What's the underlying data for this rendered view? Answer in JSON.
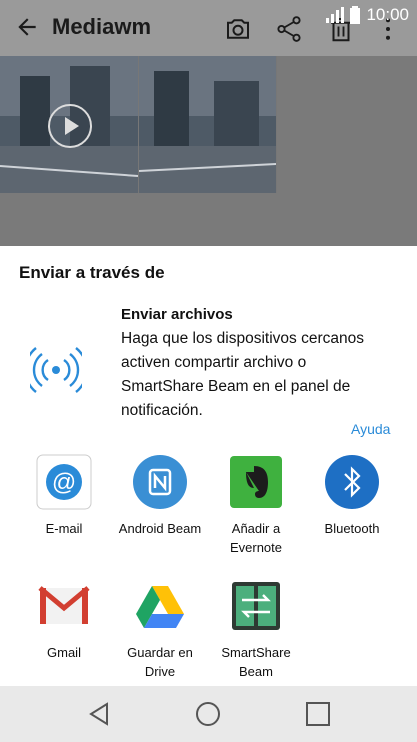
{
  "status_bar": {
    "time": "10:00"
  },
  "app_bar": {
    "title": "Mediawm"
  },
  "sheet": {
    "title": "Enviar a través de",
    "file_sharing": {
      "title": "Enviar archivos",
      "description": "Haga que los dispositivos cercanos activen compartir archivo o SmartShare Beam en el panel de notificación.",
      "help_link": "Ayuda"
    },
    "apps": [
      {
        "label": "E-mail",
        "icon": "email-icon"
      },
      {
        "label": "Android Beam",
        "icon": "android-beam-icon"
      },
      {
        "label": "Añadir a Evernote",
        "icon": "evernote-icon"
      },
      {
        "label": "Bluetooth",
        "icon": "bluetooth-icon"
      },
      {
        "label": "Gmail",
        "icon": "gmail-icon"
      },
      {
        "label": "Guardar en Drive",
        "icon": "google-drive-icon"
      },
      {
        "label": "SmartShare Beam",
        "icon": "smartshare-beam-icon"
      }
    ]
  },
  "colors": {
    "accent": "#2a8bd8",
    "sheet_bg": "#ffffff",
    "navbar_bg": "#e9e9e9"
  }
}
